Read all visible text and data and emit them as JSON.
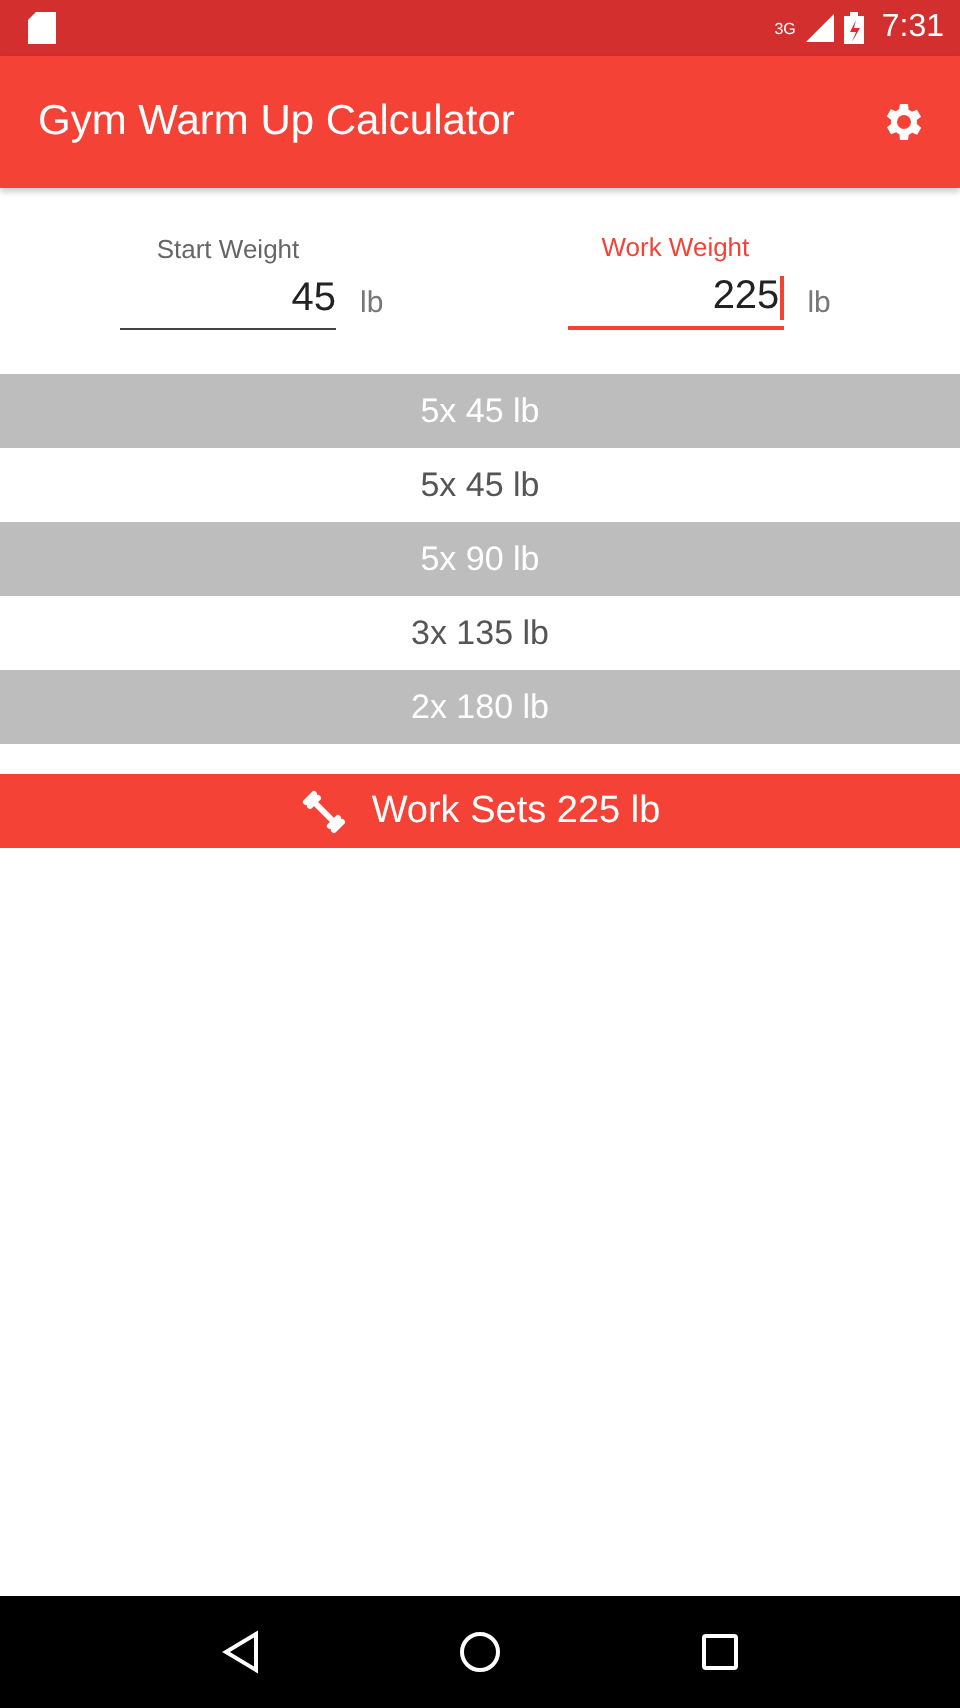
{
  "status_bar": {
    "network": "3G",
    "time": "7:31"
  },
  "app_bar": {
    "title": "Gym Warm Up Calculator"
  },
  "fields": [
    {
      "label": "Start Weight",
      "value": "45",
      "unit": "lb",
      "focused": false
    },
    {
      "label": "Work Weight",
      "value": "225",
      "unit": "lb",
      "focused": true
    }
  ],
  "warmup_sets": [
    {
      "text": "5x 45 lb",
      "shaded": true
    },
    {
      "text": "5x 45 lb",
      "shaded": false
    },
    {
      "text": "5x 90 lb",
      "shaded": true
    },
    {
      "text": "3x 135 lb",
      "shaded": false
    },
    {
      "text": "2x 180 lb",
      "shaded": true
    }
  ],
  "work_sets": {
    "text": "Work Sets 225 lb"
  }
}
